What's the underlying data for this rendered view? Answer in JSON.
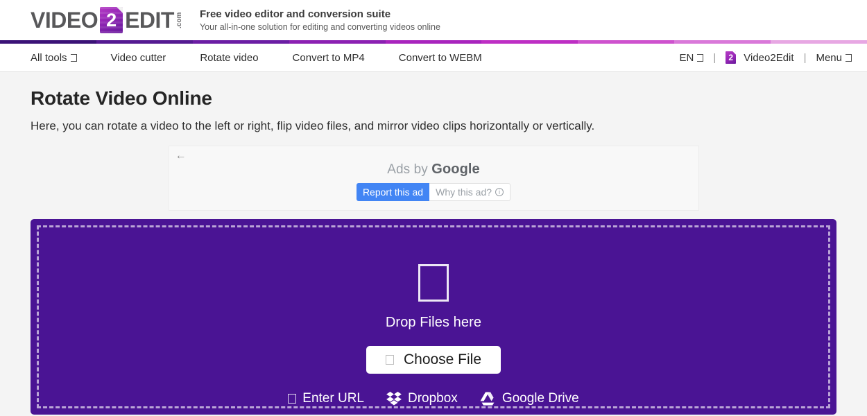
{
  "brand": {
    "logo_word_1": "VIDEO",
    "logo_badge_number": "2",
    "logo_word_2": "EDIT",
    "logo_dotcom": ".com",
    "tagline_main": "Free video editor and conversion suite",
    "tagline_sub": "Your all-in-one solution for editing and converting videos online",
    "accent_purple": "#4a1494",
    "accent_magenta": "#c12bbd",
    "gradient_strip": [
      "#3b1277",
      "#551a92",
      "#6b1da4",
      "#8b20b2",
      "#a824bd",
      "#bd2ec4",
      "#ce52ce",
      "#d978d9",
      "#e7a7e3"
    ]
  },
  "nav": {
    "left_items": [
      {
        "label": "All tools",
        "icon": "chevron-down-icon",
        "has_caret": true
      },
      {
        "label": "Video cutter",
        "has_caret": false
      },
      {
        "label": "Rotate video",
        "has_caret": false
      },
      {
        "label": "Convert to MP4",
        "has_caret": false
      },
      {
        "label": "Convert to WEBM",
        "has_caret": false
      }
    ],
    "language": "EN",
    "separator": "|",
    "account_label": "Video2Edit",
    "account_icon_number": "2",
    "menu_label": "Menu"
  },
  "main": {
    "title": "Rotate Video Online",
    "subtitle": "Here, you can rotate a video to the left or right, flip video files, and mirror video clips horizontally or vertically."
  },
  "ad": {
    "back_arrow": "←",
    "label_prefix": "Ads by ",
    "label_brand": "Google",
    "report_button": "Report this ad",
    "why_button": "Why this ad?",
    "info_icon": "i"
  },
  "dropzone": {
    "file_icon": "file-placeholder-icon",
    "drop_text": "Drop Files here",
    "choose_file_label": "Choose File",
    "choose_file_icon": "folder-placeholder-icon",
    "cloud_sources": [
      {
        "label": "Enter URL",
        "icon": "link-placeholder-icon"
      },
      {
        "label": "Dropbox",
        "icon": "dropbox-icon"
      },
      {
        "label": "Google Drive",
        "icon": "google-drive-icon"
      }
    ]
  }
}
